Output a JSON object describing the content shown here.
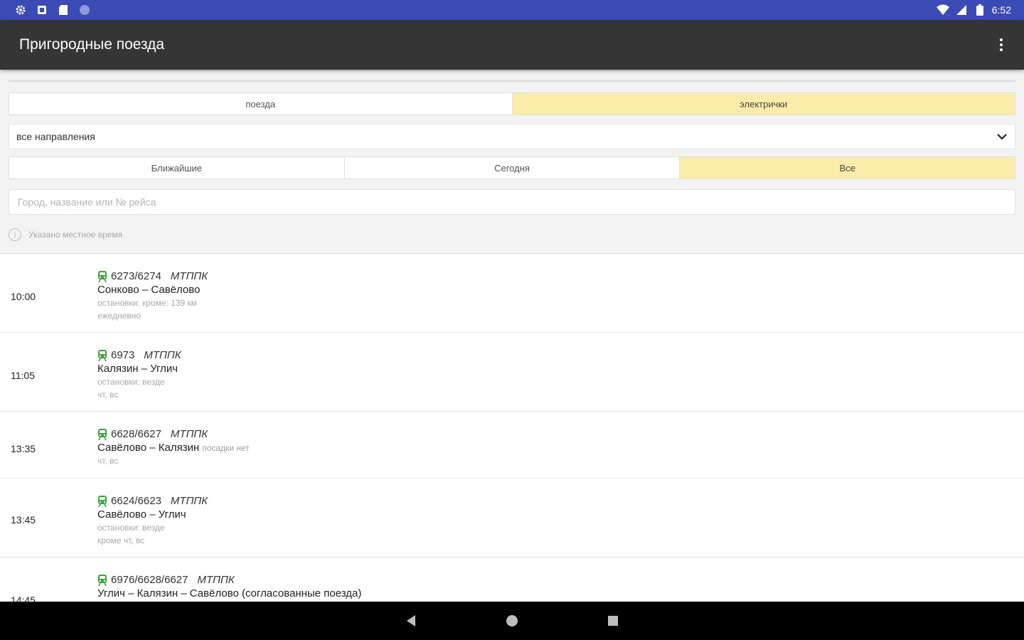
{
  "status_bar": {
    "time": "6:52",
    "left_icons": [
      "settings-icon",
      "notification-icon",
      "sd-card-icon",
      "circle-icon"
    ],
    "right_icons": [
      "wifi-icon",
      "signal-icon",
      "battery-icon"
    ]
  },
  "app_bar": {
    "title": "Пригородные поезда",
    "menu_icon": "more-vert-icon"
  },
  "type_tabs": [
    {
      "label": "поезда",
      "active": false
    },
    {
      "label": "электрички",
      "active": true
    }
  ],
  "direction": {
    "selected": "все направления"
  },
  "period_tabs": [
    {
      "label": "Ближайшие",
      "active": false
    },
    {
      "label": "Сегодня",
      "active": false
    },
    {
      "label": "Все",
      "active": true
    }
  ],
  "search": {
    "placeholder": "Город, название или № рейса"
  },
  "info": {
    "text": "Указано местное время"
  },
  "trains": [
    {
      "time": "10:00",
      "number": "6273/6274",
      "carrier": "МТППК",
      "route": "Сонково – Савёлово",
      "note": "",
      "stops": "остановки: кроме: 139 км",
      "days": "ежедневно"
    },
    {
      "time": "11:05",
      "number": "6973",
      "carrier": "МТППК",
      "route": "Калязин – Углич",
      "note": "",
      "stops": "остановки: везде",
      "days": "чт, вс"
    },
    {
      "time": "13:35",
      "number": "6628/6627",
      "carrier": "МТППК",
      "route": "Савёлово – Калязин",
      "note": "посадки нет",
      "stops": "",
      "days": "чт, вс"
    },
    {
      "time": "13:45",
      "number": "6624/6623",
      "carrier": "МТППК",
      "route": "Савёлово – Углич",
      "note": "",
      "stops": "остановки: везде",
      "days": "кроме чт, вс"
    },
    {
      "time": "14:45",
      "number": "6976/6628/6627",
      "carrier": "МТППК",
      "route": "Углич – Калязин – Савёлово (согласованные поезда)",
      "note": "",
      "stops": "",
      "days": ""
    }
  ],
  "colors": {
    "status_bar": "#3b4bb6",
    "app_bar": "#353535",
    "active_tab": "#fcecaa",
    "train_icon": "#3aa33a"
  },
  "nav_bar": [
    "back-icon",
    "home-icon",
    "recents-icon"
  ]
}
